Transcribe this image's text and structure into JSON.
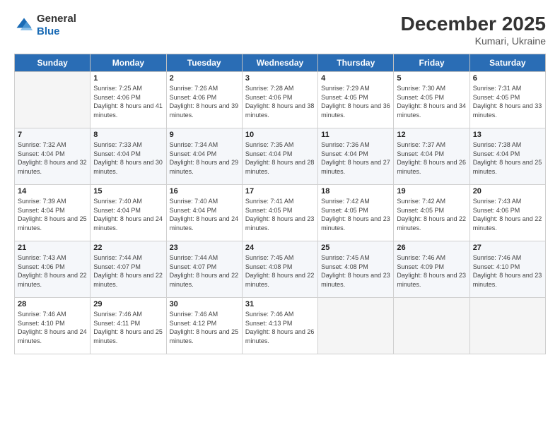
{
  "logo": {
    "general": "General",
    "blue": "Blue"
  },
  "header": {
    "month": "December 2025",
    "location": "Kumari, Ukraine"
  },
  "weekdays": [
    "Sunday",
    "Monday",
    "Tuesday",
    "Wednesday",
    "Thursday",
    "Friday",
    "Saturday"
  ],
  "weeks": [
    [
      {
        "day": "",
        "sunrise": "",
        "sunset": "",
        "daylight": ""
      },
      {
        "day": "1",
        "sunrise": "7:25 AM",
        "sunset": "4:06 PM",
        "daylight": "8 hours and 41 minutes."
      },
      {
        "day": "2",
        "sunrise": "7:26 AM",
        "sunset": "4:06 PM",
        "daylight": "8 hours and 39 minutes."
      },
      {
        "day": "3",
        "sunrise": "7:28 AM",
        "sunset": "4:06 PM",
        "daylight": "8 hours and 38 minutes."
      },
      {
        "day": "4",
        "sunrise": "7:29 AM",
        "sunset": "4:05 PM",
        "daylight": "8 hours and 36 minutes."
      },
      {
        "day": "5",
        "sunrise": "7:30 AM",
        "sunset": "4:05 PM",
        "daylight": "8 hours and 34 minutes."
      },
      {
        "day": "6",
        "sunrise": "7:31 AM",
        "sunset": "4:05 PM",
        "daylight": "8 hours and 33 minutes."
      }
    ],
    [
      {
        "day": "7",
        "sunrise": "7:32 AM",
        "sunset": "4:04 PM",
        "daylight": "8 hours and 32 minutes."
      },
      {
        "day": "8",
        "sunrise": "7:33 AM",
        "sunset": "4:04 PM",
        "daylight": "8 hours and 30 minutes."
      },
      {
        "day": "9",
        "sunrise": "7:34 AM",
        "sunset": "4:04 PM",
        "daylight": "8 hours and 29 minutes."
      },
      {
        "day": "10",
        "sunrise": "7:35 AM",
        "sunset": "4:04 PM",
        "daylight": "8 hours and 28 minutes."
      },
      {
        "day": "11",
        "sunrise": "7:36 AM",
        "sunset": "4:04 PM",
        "daylight": "8 hours and 27 minutes."
      },
      {
        "day": "12",
        "sunrise": "7:37 AM",
        "sunset": "4:04 PM",
        "daylight": "8 hours and 26 minutes."
      },
      {
        "day": "13",
        "sunrise": "7:38 AM",
        "sunset": "4:04 PM",
        "daylight": "8 hours and 25 minutes."
      }
    ],
    [
      {
        "day": "14",
        "sunrise": "7:39 AM",
        "sunset": "4:04 PM",
        "daylight": "8 hours and 25 minutes."
      },
      {
        "day": "15",
        "sunrise": "7:40 AM",
        "sunset": "4:04 PM",
        "daylight": "8 hours and 24 minutes."
      },
      {
        "day": "16",
        "sunrise": "7:40 AM",
        "sunset": "4:04 PM",
        "daylight": "8 hours and 24 minutes."
      },
      {
        "day": "17",
        "sunrise": "7:41 AM",
        "sunset": "4:05 PM",
        "daylight": "8 hours and 23 minutes."
      },
      {
        "day": "18",
        "sunrise": "7:42 AM",
        "sunset": "4:05 PM",
        "daylight": "8 hours and 23 minutes."
      },
      {
        "day": "19",
        "sunrise": "7:42 AM",
        "sunset": "4:05 PM",
        "daylight": "8 hours and 22 minutes."
      },
      {
        "day": "20",
        "sunrise": "7:43 AM",
        "sunset": "4:06 PM",
        "daylight": "8 hours and 22 minutes."
      }
    ],
    [
      {
        "day": "21",
        "sunrise": "7:43 AM",
        "sunset": "4:06 PM",
        "daylight": "8 hours and 22 minutes."
      },
      {
        "day": "22",
        "sunrise": "7:44 AM",
        "sunset": "4:07 PM",
        "daylight": "8 hours and 22 minutes."
      },
      {
        "day": "23",
        "sunrise": "7:44 AM",
        "sunset": "4:07 PM",
        "daylight": "8 hours and 22 minutes."
      },
      {
        "day": "24",
        "sunrise": "7:45 AM",
        "sunset": "4:08 PM",
        "daylight": "8 hours and 22 minutes."
      },
      {
        "day": "25",
        "sunrise": "7:45 AM",
        "sunset": "4:08 PM",
        "daylight": "8 hours and 23 minutes."
      },
      {
        "day": "26",
        "sunrise": "7:46 AM",
        "sunset": "4:09 PM",
        "daylight": "8 hours and 23 minutes."
      },
      {
        "day": "27",
        "sunrise": "7:46 AM",
        "sunset": "4:10 PM",
        "daylight": "8 hours and 23 minutes."
      }
    ],
    [
      {
        "day": "28",
        "sunrise": "7:46 AM",
        "sunset": "4:10 PM",
        "daylight": "8 hours and 24 minutes."
      },
      {
        "day": "29",
        "sunrise": "7:46 AM",
        "sunset": "4:11 PM",
        "daylight": "8 hours and 25 minutes."
      },
      {
        "day": "30",
        "sunrise": "7:46 AM",
        "sunset": "4:12 PM",
        "daylight": "8 hours and 25 minutes."
      },
      {
        "day": "31",
        "sunrise": "7:46 AM",
        "sunset": "4:13 PM",
        "daylight": "8 hours and 26 minutes."
      },
      {
        "day": "",
        "sunrise": "",
        "sunset": "",
        "daylight": ""
      },
      {
        "day": "",
        "sunrise": "",
        "sunset": "",
        "daylight": ""
      },
      {
        "day": "",
        "sunrise": "",
        "sunset": "",
        "daylight": ""
      }
    ]
  ],
  "labels": {
    "sunrise": "Sunrise:",
    "sunset": "Sunset:",
    "daylight": "Daylight:"
  }
}
